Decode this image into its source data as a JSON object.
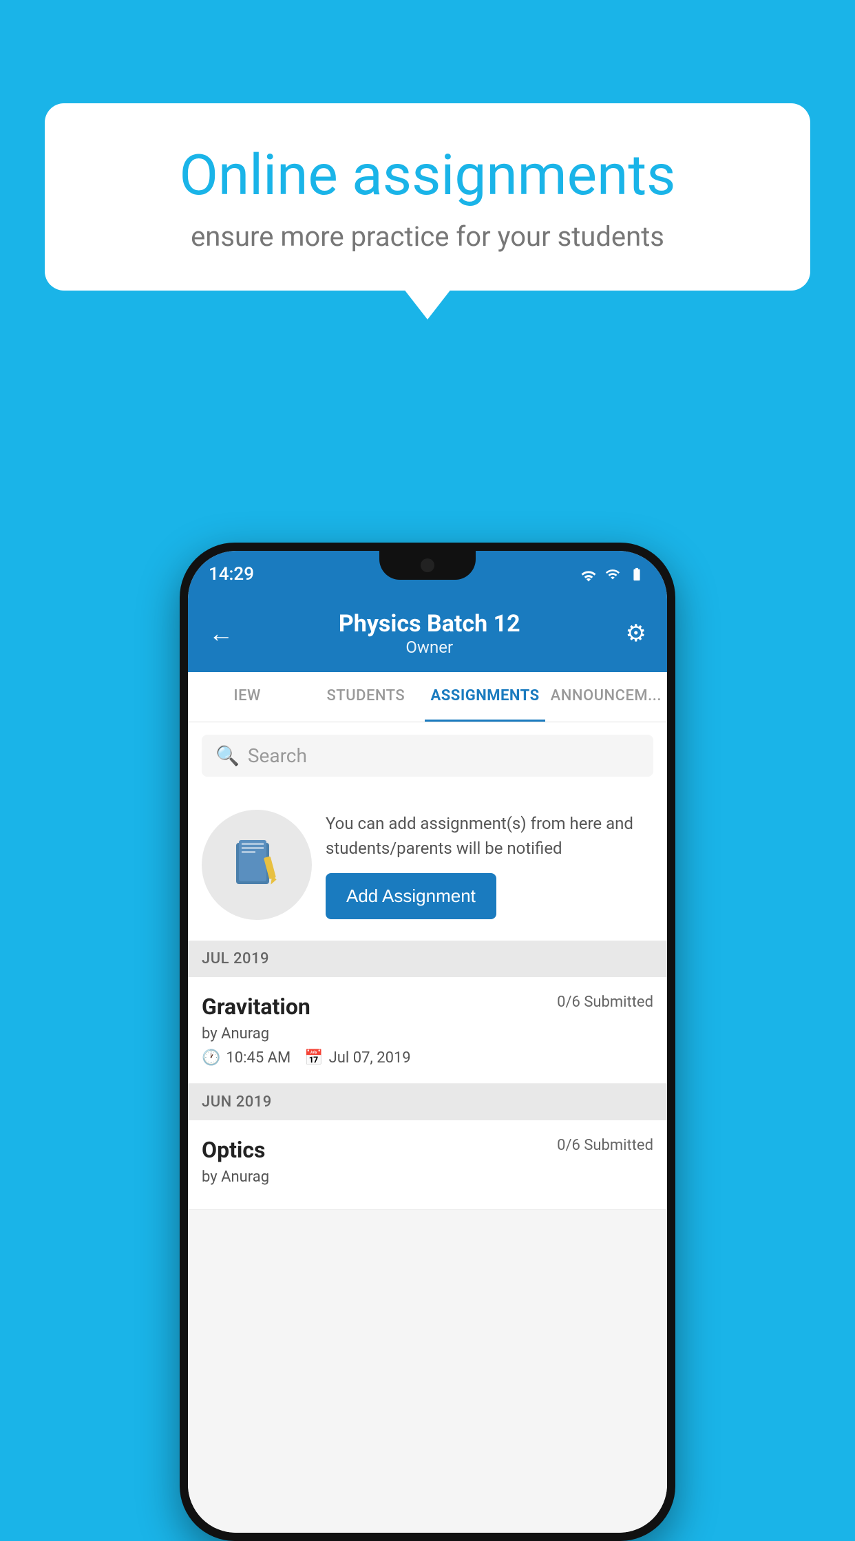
{
  "background_color": "#1ab4e8",
  "speech_bubble": {
    "title": "Online assignments",
    "subtitle": "ensure more practice for your students"
  },
  "phone": {
    "status_bar": {
      "time": "14:29",
      "icons": [
        "wifi",
        "signal",
        "battery"
      ]
    },
    "header": {
      "title": "Physics Batch 12",
      "subtitle": "Owner",
      "back_label": "←",
      "gear_label": "⚙"
    },
    "tabs": [
      {
        "label": "IEW",
        "active": false
      },
      {
        "label": "STUDENTS",
        "active": false
      },
      {
        "label": "ASSIGNMENTS",
        "active": true
      },
      {
        "label": "ANNOUNCEM...",
        "active": false
      }
    ],
    "search": {
      "placeholder": "Search"
    },
    "promo": {
      "description": "You can add assignment(s) from here and students/parents will be notified",
      "button_label": "Add Assignment"
    },
    "sections": [
      {
        "month_label": "JUL 2019",
        "assignments": [
          {
            "name": "Gravitation",
            "submitted": "0/6 Submitted",
            "by": "by Anurag",
            "time": "10:45 AM",
            "date": "Jul 07, 2019"
          }
        ]
      },
      {
        "month_label": "JUN 2019",
        "assignments": [
          {
            "name": "Optics",
            "submitted": "0/6 Submitted",
            "by": "by Anurag",
            "time": "",
            "date": ""
          }
        ]
      }
    ]
  }
}
